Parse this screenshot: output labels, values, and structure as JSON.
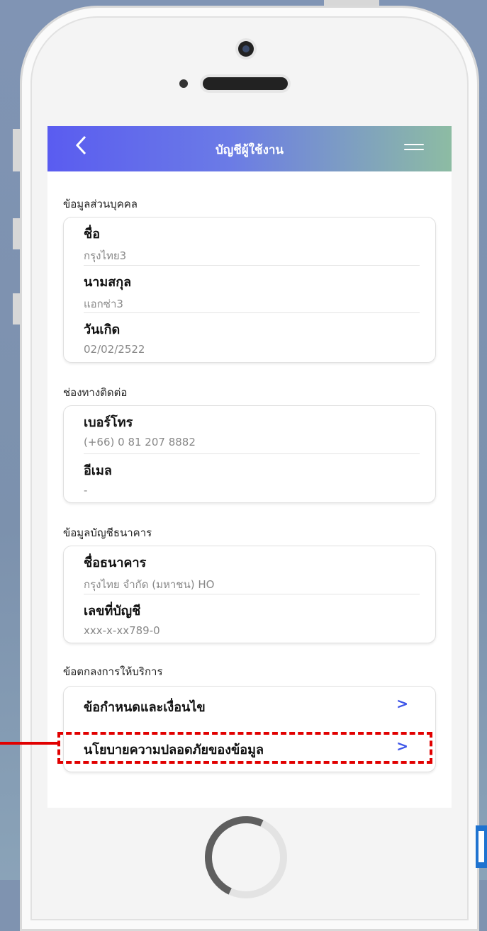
{
  "header": {
    "back_icon": "chevron-left-icon",
    "title": "บัญชีผู้ใช้งาน",
    "menu_icon": "hamburger-menu-icon"
  },
  "personal": {
    "section_title": "ข้อมูลส่วนบุคคล",
    "fields": [
      {
        "label": "ชื่อ",
        "value": "กรุงไทย3"
      },
      {
        "label": "นามสกุล",
        "value": "แอกซ่า3"
      },
      {
        "label": "วันเกิด",
        "value": "02/02/2522"
      }
    ]
  },
  "contact": {
    "section_title": "ช่องทางติดต่อ",
    "fields": [
      {
        "label": "เบอร์โทร",
        "value": "(+66) 0 81 207 8882"
      },
      {
        "label": "อีเมล",
        "value": "-"
      }
    ]
  },
  "bank": {
    "section_title": "ข้อมูลบัญชีธนาคาร",
    "fields": [
      {
        "label": "ชื่อธนาคาร",
        "value": "กรุงไทย จำกัด (มหาชน) HO"
      },
      {
        "label": "เลขที่บัญชี",
        "value": "xxx-x-xx789-0"
      }
    ]
  },
  "terms": {
    "section_title": "ข้อตกลงการให้บริการ",
    "links": [
      {
        "label": "ข้อกำหนดและเงื่อนไข",
        "chevron": ">"
      },
      {
        "label": "นโยบายความปลอดภัยของข้อมูล",
        "chevron": ">"
      }
    ]
  },
  "colors": {
    "header_start": "#5a5cf0",
    "header_end": "#8dbca3",
    "chevron": "#3d55e8",
    "highlight": "#e10000"
  }
}
